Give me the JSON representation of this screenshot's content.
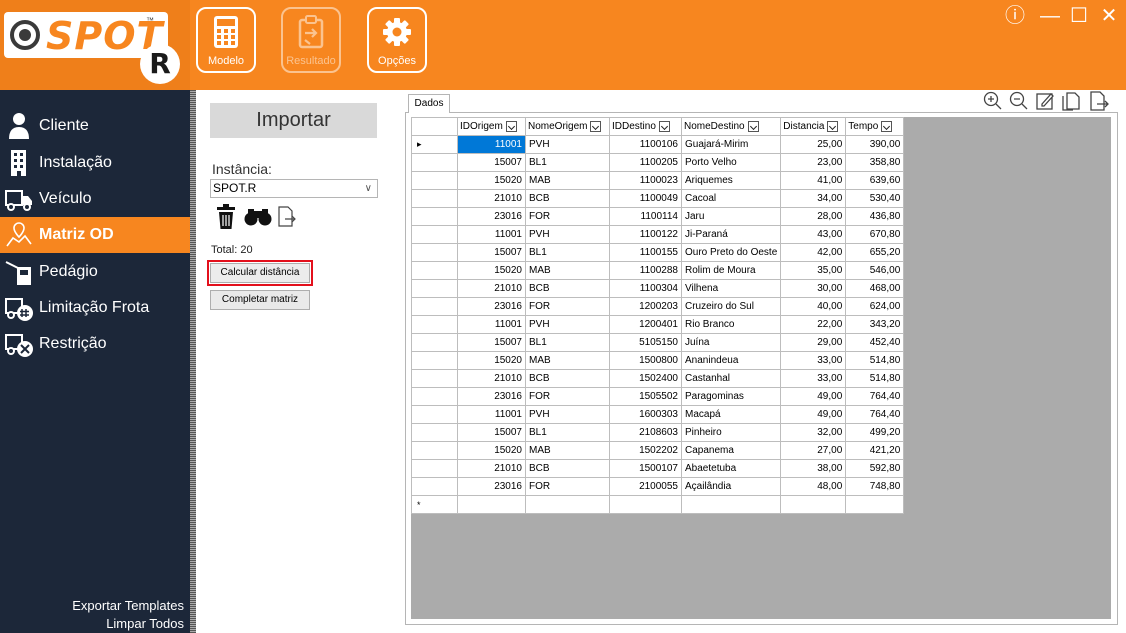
{
  "app": {
    "logo_text": "SPOT",
    "logo_tm": "™",
    "logo_badge": "R"
  },
  "toolbar": {
    "buttons": [
      {
        "label": "Modelo",
        "icon": "calculator-icon",
        "enabled": true
      },
      {
        "label": "Resultado",
        "icon": "clipboard-export-icon",
        "enabled": false
      },
      {
        "label": "Opções",
        "icon": "gear-icon",
        "enabled": true
      }
    ]
  },
  "window_controls": {
    "info": "ⓘ",
    "minimize": "—",
    "maximize": "☐",
    "close": "✕"
  },
  "sidebar": {
    "items": [
      {
        "label": "Cliente",
        "icon": "person-icon"
      },
      {
        "label": "Instalação",
        "icon": "building-icon"
      },
      {
        "label": "Veículo",
        "icon": "truck-icon"
      },
      {
        "label": "Matriz OD",
        "icon": "route-pin-icon",
        "active": true
      },
      {
        "label": "Pedágio",
        "icon": "toll-icon"
      },
      {
        "label": "Limitação Frota",
        "icon": "truck-hash-icon"
      },
      {
        "label": "Restrição",
        "icon": "truck-block-icon"
      }
    ],
    "footer": [
      "Exportar Templates",
      "Limpar Todos"
    ]
  },
  "left_panel": {
    "import_label": "Importar",
    "instance_label": "Instância:",
    "instance_value": "SPOT.R",
    "total_label": "Total: 20",
    "calc_distance_label": "Calcular distância",
    "complete_matrix_label": "Completar matriz"
  },
  "data_panel": {
    "tab_label": "Dados",
    "tools": [
      "zoom-in-icon",
      "zoom-out-icon",
      "edit-icon",
      "copy-icon",
      "export-icon"
    ],
    "columns": [
      "IDOrigem",
      "NomeOrigem",
      "IDDestino",
      "NomeDestino",
      "Distancia",
      "Tempo"
    ],
    "rows": [
      [
        "11001",
        "PVH",
        "1100106",
        "Guajará-Mirim",
        "25,00",
        "390,00"
      ],
      [
        "15007",
        "BL1",
        "1100205",
        "Porto Velho",
        "23,00",
        "358,80"
      ],
      [
        "15020",
        "MAB",
        "1100023",
        "Ariquemes",
        "41,00",
        "639,60"
      ],
      [
        "21010",
        "BCB",
        "1100049",
        "Cacoal",
        "34,00",
        "530,40"
      ],
      [
        "23016",
        "FOR",
        "1100114",
        "Jaru",
        "28,00",
        "436,80"
      ],
      [
        "11001",
        "PVH",
        "1100122",
        "Ji-Paraná",
        "43,00",
        "670,80"
      ],
      [
        "15007",
        "BL1",
        "1100155",
        "Ouro Preto do Oeste",
        "42,00",
        "655,20"
      ],
      [
        "15020",
        "MAB",
        "1100288",
        "Rolim de Moura",
        "35,00",
        "546,00"
      ],
      [
        "21010",
        "BCB",
        "1100304",
        "Vilhena",
        "30,00",
        "468,00"
      ],
      [
        "23016",
        "FOR",
        "1200203",
        "Cruzeiro do Sul",
        "40,00",
        "624,00"
      ],
      [
        "11001",
        "PVH",
        "1200401",
        "Rio Branco",
        "22,00",
        "343,20"
      ],
      [
        "15007",
        "BL1",
        "5105150",
        "Juína",
        "29,00",
        "452,40"
      ],
      [
        "15020",
        "MAB",
        "1500800",
        "Ananindeua",
        "33,00",
        "514,80"
      ],
      [
        "21010",
        "BCB",
        "1502400",
        "Castanhal",
        "33,00",
        "514,80"
      ],
      [
        "23016",
        "FOR",
        "1505502",
        "Paragominas",
        "49,00",
        "764,40"
      ],
      [
        "11001",
        "PVH",
        "1600303",
        "Macapá",
        "49,00",
        "764,40"
      ],
      [
        "15007",
        "BL1",
        "2108603",
        "Pinheiro",
        "32,00",
        "499,20"
      ],
      [
        "15020",
        "MAB",
        "1502202",
        "Capanema",
        "27,00",
        "421,20"
      ],
      [
        "21010",
        "BCB",
        "1500107",
        "Abaetetuba",
        "38,00",
        "592,80"
      ],
      [
        "23016",
        "FOR",
        "2100055",
        "Açailândia",
        "48,00",
        "748,80"
      ]
    ],
    "selected_row": 0,
    "current_row_marker": "▸",
    "new_row_marker": "*"
  },
  "colors": {
    "accent": "#f7861f",
    "sidebar": "#1c2739",
    "selection": "#0078d7",
    "highlight": "#e3101c"
  }
}
